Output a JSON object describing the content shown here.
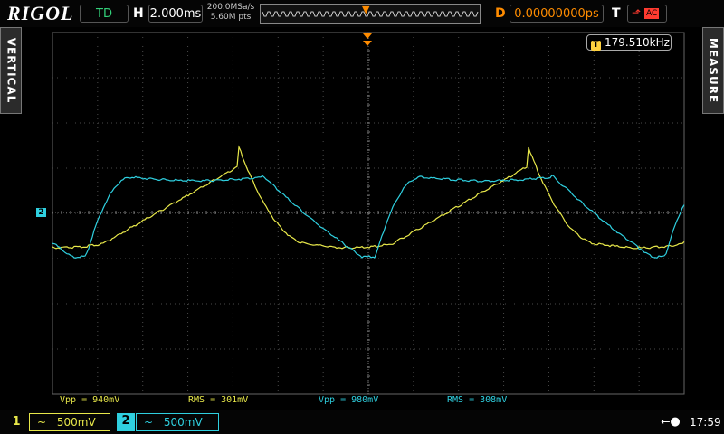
{
  "brand": "RIGOL",
  "header": {
    "trigger_status": "TD",
    "horizontal": {
      "label": "H",
      "value": "2.000ms"
    },
    "sample_rate": "200.0MSa/s",
    "memory_depth": "5.60M pts",
    "delay": {
      "label": "D",
      "value": "0.00000000ps"
    },
    "trigger": {
      "label": "T",
      "coupling": "AC"
    }
  },
  "side_tabs": {
    "left": "VERTICAL",
    "right": "MEASURE"
  },
  "frequency_counter": {
    "value": "179.510kHz"
  },
  "measurements": [
    {
      "text": "Vpp = 940mV",
      "channel": "1"
    },
    {
      "text": "RMS = 301mV",
      "channel": "1"
    },
    {
      "text": "Vpp = 980mV",
      "channel": "2"
    },
    {
      "text": "RMS = 308mV",
      "channel": "2"
    }
  ],
  "channels": [
    {
      "number": "1",
      "coupling_symbol": "~",
      "scale": "500mV",
      "color": "#e8e84a"
    },
    {
      "number": "2",
      "coupling_symbol": "~",
      "scale": "500mV",
      "color": "#2fd0e0"
    }
  ],
  "ch2_marker": "2",
  "status": {
    "usb_icon": "usb-icon",
    "time": "17:59"
  },
  "colors": {
    "ch1": "#e8e84a",
    "ch2": "#2fd0e0",
    "trigger": "#ff8c00",
    "grid": "#4a4a4a"
  }
}
